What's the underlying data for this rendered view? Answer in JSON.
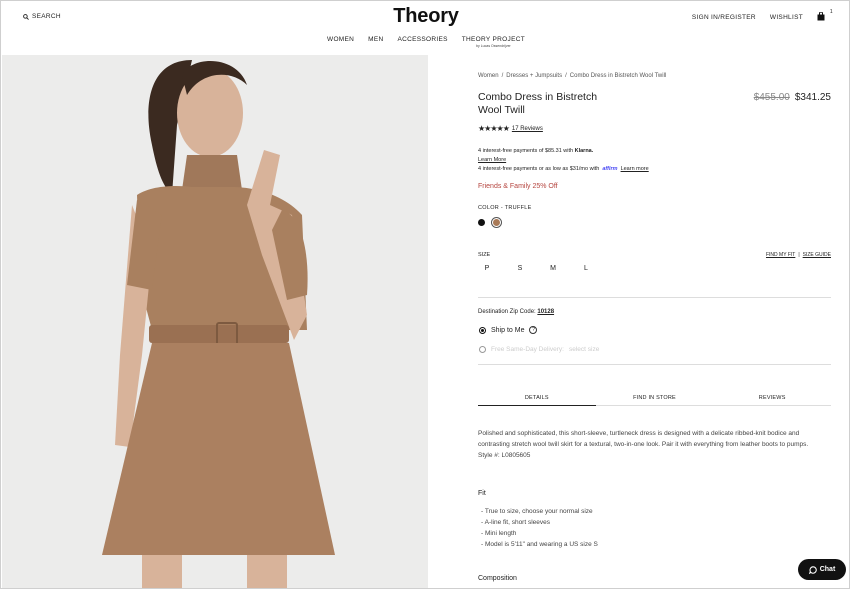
{
  "header": {
    "search_label": "SEARCH",
    "logo": "Theory",
    "sign_in": "SIGN IN/REGISTER",
    "wishlist": "WISHLIST",
    "bag_count": "1"
  },
  "nav": [
    {
      "label": "WOMEN",
      "sub": ""
    },
    {
      "label": "MEN",
      "sub": ""
    },
    {
      "label": "ACCESSORIES",
      "sub": ""
    },
    {
      "label": "THEORY PROJECT",
      "sub": "by Lucas Ossendrijver"
    }
  ],
  "breadcrumb": [
    "Women",
    "/",
    "Dresses + Jumpsuits",
    "/",
    "Combo Dress in Bistretch Wool Twill"
  ],
  "product": {
    "title": "Combo Dress in Bistretch Wool Twill",
    "price_original": "$455.00",
    "price_sale": "$341.25",
    "stars": "★★★★★",
    "reviews": "17 Reviews",
    "klarna_text": "4 interest-free payments of $85.31 with",
    "klarna_brand": "Klarna.",
    "learn_more": "Learn More",
    "affirm_text": "4 interest-free payments or as low as $31/mo with",
    "affirm_brand": "affirm",
    "affirm_learn_more": "Learn more",
    "promo": "Friends & Family 25% Off",
    "color_label": "COLOR - TRUFFLE",
    "size_label": "SIZE",
    "find_my_fit": "FIND MY FIT",
    "size_sep": "|",
    "size_guide": "SIZE GUIDE",
    "sizes": [
      "P",
      "S",
      "M",
      "L"
    ],
    "zip_label": "Destination Zip Code:",
    "zip_value": "10128",
    "ship_label": "Ship to Me",
    "sameday_label": "Free Same-Day Delivery:",
    "sameday_note": "select size"
  },
  "tabs": [
    "DETAILS",
    "FIND IN STORE",
    "REVIEWS"
  ],
  "details": {
    "description": "Polished and sophisticated, this short-sleeve, turtleneck dress is designed with a delicate ribbed-knit bodice and contrasting stretch wool twill skirt for a textural, two-in-one look. Pair it with everything from leather boots to pumps.",
    "style": "Style #: L0805605",
    "fit_heading": "Fit",
    "fit_items": [
      "- True to size, choose your normal size",
      "- A-line fit, short sleeves",
      "- Mini length",
      "- Model is 5'11\" and wearing a US size S"
    ],
    "composition_heading": "Composition"
  },
  "chat_label": "Chat",
  "colors": {
    "accent_promo": "#b5443e",
    "swatch_black": "#111111",
    "swatch_truffle": "#a97a57",
    "affirm": "#4a4af4"
  }
}
